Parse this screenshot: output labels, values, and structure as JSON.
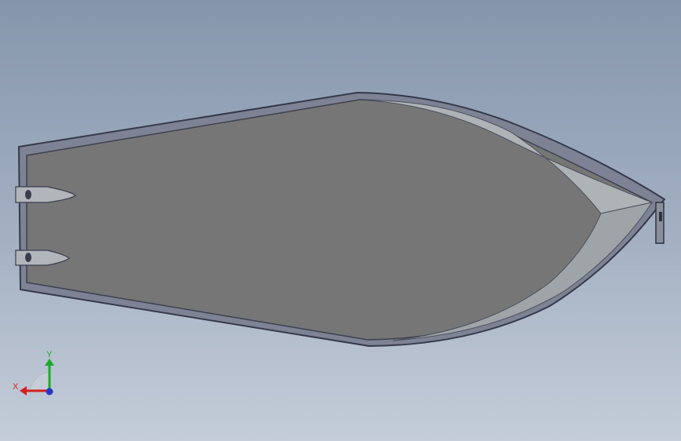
{
  "view_triad": {
    "x_label": "X",
    "y_label": "Y",
    "x_color": "#d42020",
    "y_color": "#1ea82b",
    "z_color": "#2438c8"
  },
  "colors": {
    "background_top": "#8596ac",
    "background_bottom": "#c4cdd9",
    "hull_edge": "#3a3d4e",
    "hull_rim": "#7a7f91",
    "deck_fill": "#777777",
    "bow_surface": "#b7bcbf"
  },
  "model": {
    "name_icon": "boat-hull-top-view",
    "parts": [
      "hull-rim",
      "deck-surface",
      "bow-panel",
      "port-strut",
      "starboard-strut",
      "bow-cleat"
    ]
  }
}
